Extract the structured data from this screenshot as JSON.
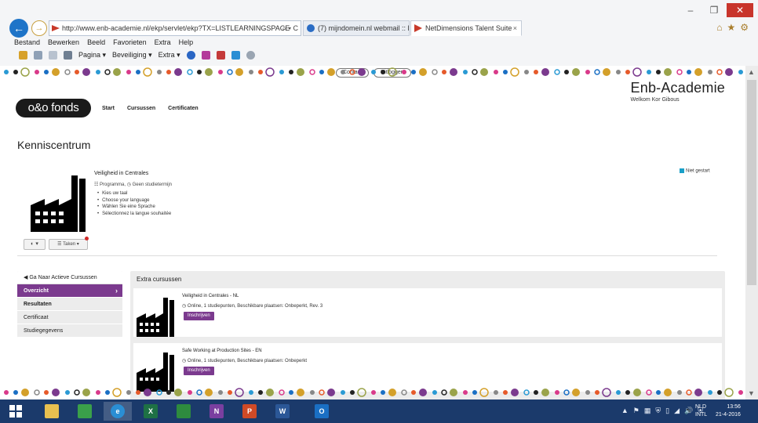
{
  "window": {
    "minimize": "–",
    "maximize": "❐",
    "close": "✕"
  },
  "browser": {
    "back": "←",
    "forward": "→",
    "address": "http://www.enb-academie.nl/ekp/servlet/ekp?TX=LISTLEARNINGSPACE",
    "address_tools": "⌕ ▾ C",
    "tabs": [
      {
        "label": "(7) mijndomein.nl webmail :: P...",
        "close": ""
      },
      {
        "label": "NetDimensions Talent Suite",
        "close": "×"
      }
    ],
    "fav_tools": [
      "⌂",
      "★",
      "⚙"
    ],
    "menu": [
      "Bestand",
      "Bewerken",
      "Beeld",
      "Favorieten",
      "Extra",
      "Help"
    ],
    "commands": [
      "Pagina ▾",
      "Beveiliging ▾",
      "Extra ▾"
    ]
  },
  "page": {
    "top_links": {
      "contact": "Contact",
      "logout": "Uitloggen"
    },
    "brand": "Enb-Academie",
    "welcome": "Welkom Kor Gibous",
    "logo": "o&o fonds",
    "nav": [
      "Start",
      "Cursussen",
      "Certificaten"
    ],
    "section_title": "Kenniscentrum",
    "course": {
      "title": "Veiligheid in Centrales",
      "meta": "☷ Programma,  ◷ Geen studietermijn",
      "languages": [
        "Kies uw taal",
        "Choose your language",
        "Wählen Sie eine Sprache",
        "Sélectionnez la langue souhaitée"
      ],
      "status": "Niet gestart",
      "info_btn": "◐ ▾",
      "tasks_btn": "☰ Taken ▾"
    },
    "leftnav": {
      "back": "Ga Naar Actieve Cursussen",
      "items": [
        "Overzicht",
        "Resultaten",
        "Certificaat",
        "Studiegegevens"
      ],
      "active_chevron": "›"
    },
    "extra": {
      "title": "Extra cursussen",
      "cards": [
        {
          "title": "Veiligheid in Centrales - NL",
          "meta": "◷ Online, 1 studiepunten, Beschikbare plaatsen: Onbeperkt, Rev. 3",
          "button": "Inschrijven"
        },
        {
          "title": "Safe Working at Production Sites - EN",
          "meta": "◷ Online, 1 studiepunten, Beschikbare plaatsen: Onbeperkt",
          "button": "Inschrijven"
        }
      ]
    }
  },
  "taskbar": {
    "tray": [
      "▲",
      "⚑",
      "▦",
      "⛨",
      "▯",
      "◢",
      "🔊",
      "⛨"
    ],
    "lang_top": "NLD",
    "lang_bottom": "INTL",
    "time": "13:56",
    "date": "21-4-2016"
  },
  "colors": {
    "accent": "#7b3a8e",
    "status": "#1aa0c8",
    "taskbar": "#1b3a6b",
    "ie_blue": "#1e74c8"
  }
}
